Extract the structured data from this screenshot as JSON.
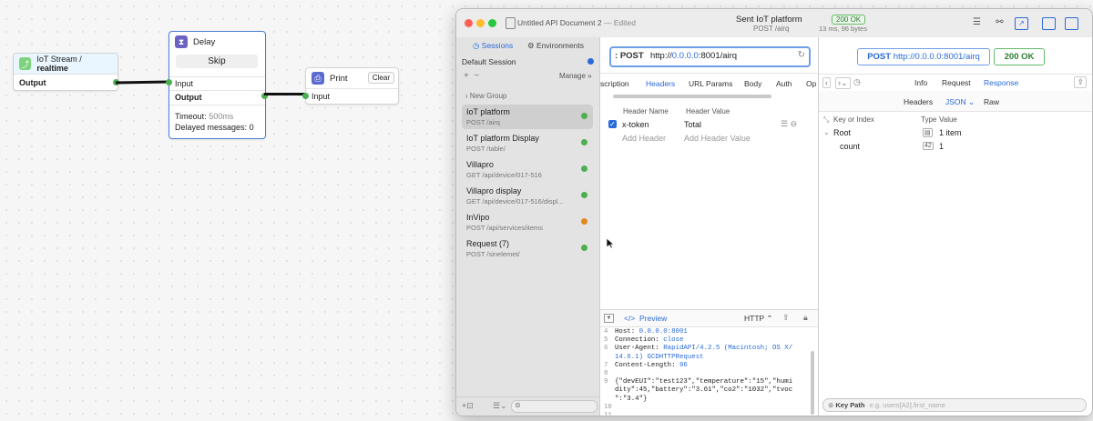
{
  "flow": {
    "iot_node": {
      "title_a": "IoT Stream / ",
      "title_b": "realtime",
      "output": "Output"
    },
    "delay_node": {
      "title": "Delay",
      "skip": "Skip",
      "input": "Input",
      "output": "Output",
      "timeout_label": "Timeout:",
      "timeout_value": "500ms",
      "delayed_label": "Delayed messages:",
      "delayed_value": "0"
    },
    "print_node": {
      "title": "Print",
      "clear": "Clear",
      "input": "Input"
    }
  },
  "window": {
    "doc_title": "Untitled API Document 2",
    "doc_status": "— Edited",
    "status_title": "Sent IoT platform",
    "status_sub": "POST /airq",
    "status_code": "200 OK",
    "timing": "13 ms, 96 bytes"
  },
  "sidebar": {
    "sessions_tab": "Sessions",
    "environments_tab": "Environments",
    "session_name": "Default Session",
    "manage": "Manage",
    "group": "New Group",
    "items": [
      {
        "name": "IoT platform",
        "path": "POST /airq",
        "color": "#4caf50"
      },
      {
        "name": "IoT platform Display",
        "path": "POST /table/",
        "color": "#4caf50"
      },
      {
        "name": "Villapro",
        "path": "GET /api/device/017-516",
        "color": "#4caf50"
      },
      {
        "name": "Villapro display",
        "path": "GET /api/device/017-516/displ...",
        "color": "#4caf50"
      },
      {
        "name": "InVipo",
        "path": "POST /api/services/items",
        "color": "#e08a1e"
      },
      {
        "name": "Request (7)",
        "path": "POST /sinelemet/",
        "color": "#4caf50"
      }
    ]
  },
  "request": {
    "method": "POST",
    "url_a": "http://",
    "url_b": "0.0.0.0",
    "url_c": ":8001/airq",
    "tabs": [
      "scription",
      "Headers",
      "URL Params",
      "Body",
      "Auth",
      "Op"
    ],
    "col_name": "Header Name",
    "col_value": "Header Value",
    "header_name": "x-token",
    "header_value": "Total",
    "add_name": "Add Header",
    "add_value": "Add Header Value",
    "preview_label": "Preview",
    "http_label": "HTTP",
    "preview_lines": [
      {
        "n": "4",
        "k": "Host: ",
        "v": "0.0.0.0:8001"
      },
      {
        "n": "5",
        "k": "Connection: ",
        "v": "close"
      },
      {
        "n": "6",
        "k": "User-Agent: ",
        "v": "RapidAPI/4.2.5 (Macintosh; OS X/"
      },
      {
        "n": "",
        "k": "",
        "v": "14.6.1) GCDHTTPRequest"
      },
      {
        "n": "7",
        "k": "Content-Length: ",
        "v": "96"
      },
      {
        "n": "8",
        "k": "",
        "v": ""
      },
      {
        "n": "9",
        "k": "{\"devEUI\":\"test123\",\"temperature\":\"15\",\"humi",
        "v": ""
      },
      {
        "n": "",
        "k": "dity\":45,\"battery\":\"3.61\",\"co2\":\"1032\",\"tvoc",
        "v": ""
      },
      {
        "n": "",
        "k": "\":\"3.4\"}",
        "v": ""
      },
      {
        "n": "10",
        "k": "",
        "v": ""
      },
      {
        "n": "11",
        "k": "",
        "v": ""
      }
    ]
  },
  "response": {
    "method": "POST",
    "url": "http://0.0.0.0:8001/airq",
    "status": "200 OK",
    "tabs": {
      "info": "Info",
      "request": "Request",
      "response": "Response"
    },
    "subtabs": {
      "headers": "Headers",
      "json": "JSON",
      "raw": "Raw"
    },
    "col_key": "Key or Index",
    "col_type": "Type",
    "col_value": "Value",
    "root_key": "Root",
    "root_value": "1 item",
    "count_key": "count",
    "count_type": "42",
    "count_value": "1",
    "keypath_label": "Key Path",
    "keypath_placeholder": "e.g. users[A2].first_name"
  }
}
